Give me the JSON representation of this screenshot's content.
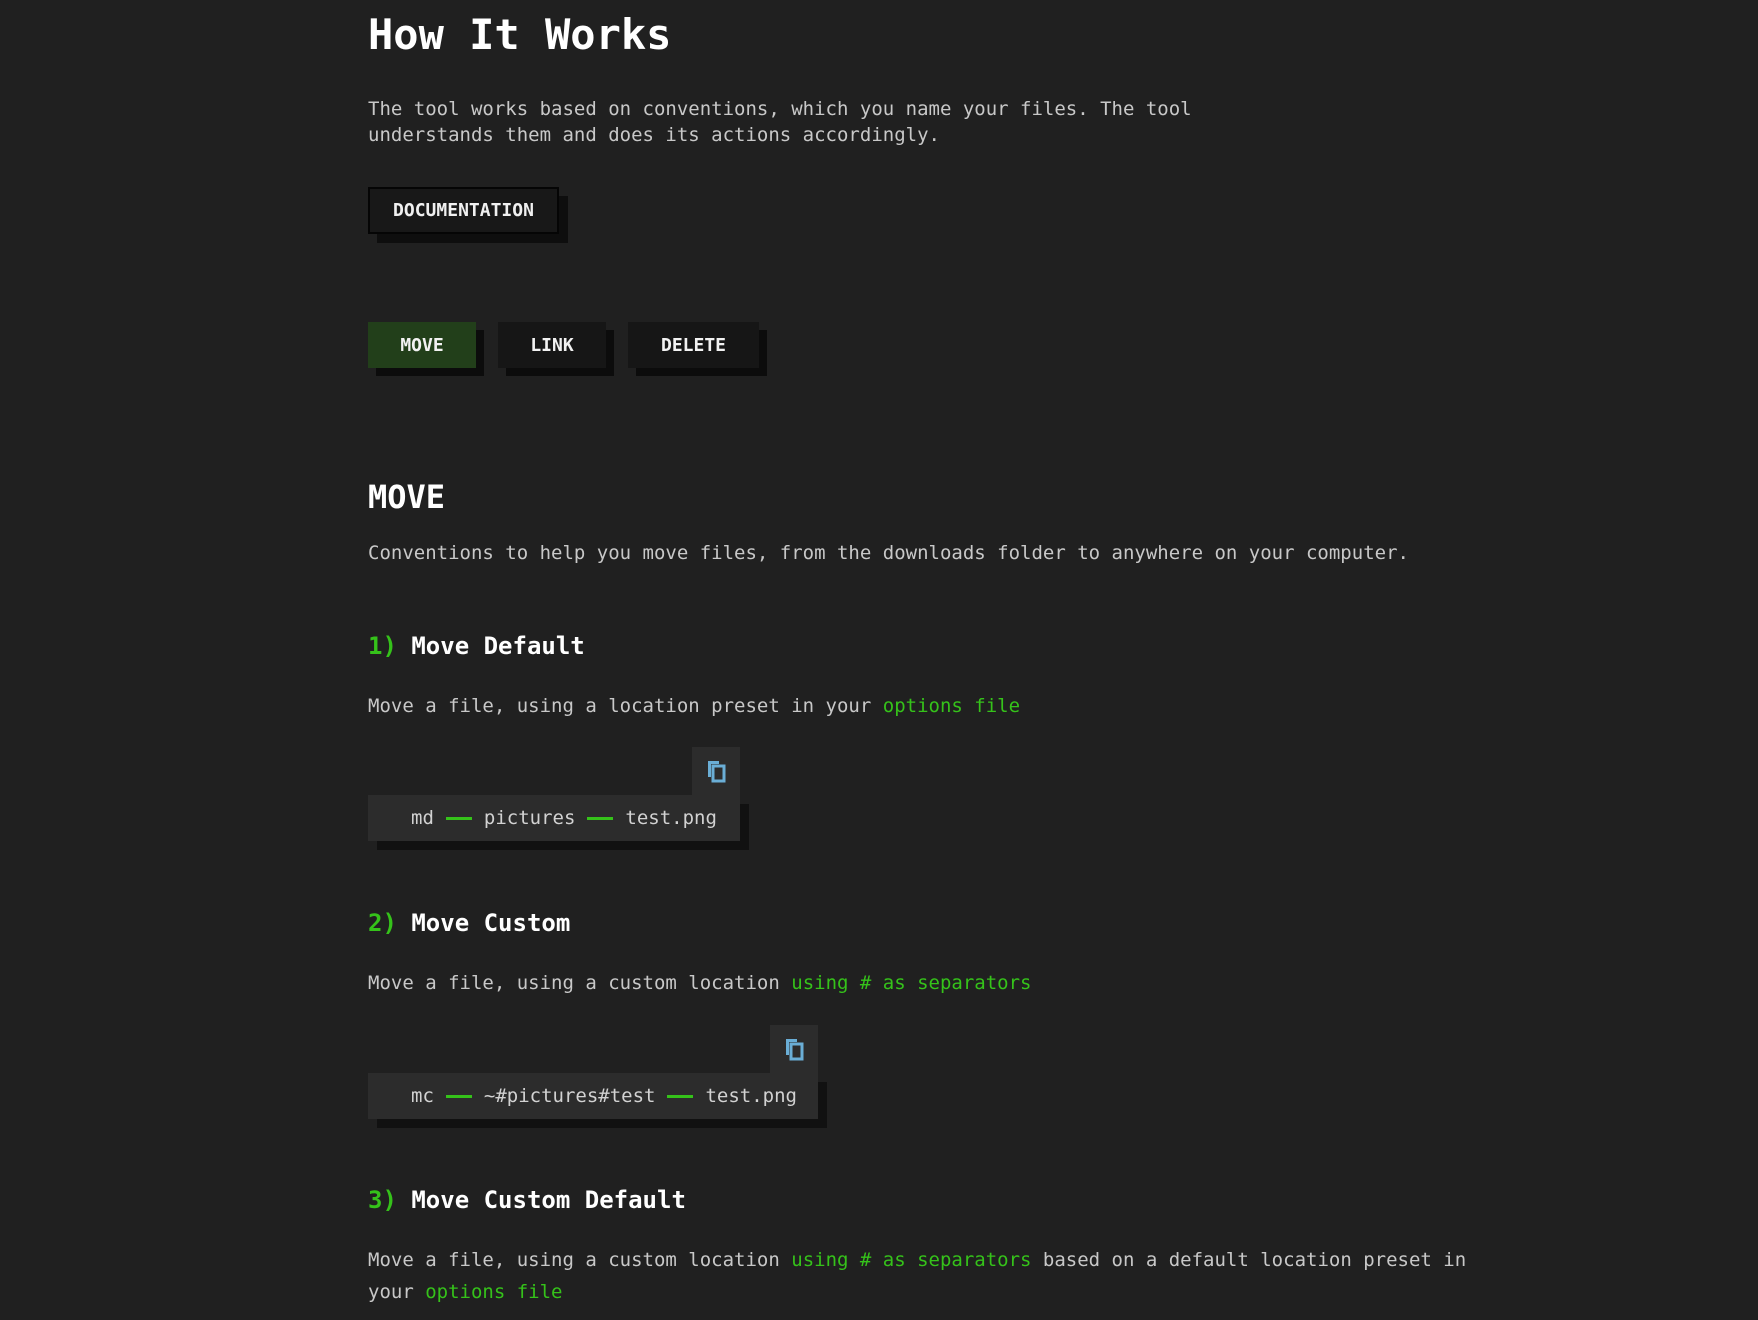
{
  "page": {
    "title": "How It Works",
    "intro_line1": "The tool works based on conventions, which you name your files. The tool",
    "intro_line2": "understands them and does its actions accordingly.",
    "doc_button": "DOCUMENTATION"
  },
  "tabs": [
    {
      "label": "MOVE",
      "active": true
    },
    {
      "label": "LINK",
      "active": false
    },
    {
      "label": "DELETE",
      "active": false
    }
  ],
  "section": {
    "title": "MOVE",
    "description": "Conventions to help you move files, from the downloads folder to anywhere on your computer."
  },
  "items": [
    {
      "number": "1)",
      "title": "Move Default",
      "desc_prefix": "Move a file, using a location preset in your ",
      "desc_link": "options file",
      "code": {
        "cmd": "md",
        "arg": "pictures",
        "file": "test.png"
      }
    },
    {
      "number": "2)",
      "title": "Move Custom",
      "desc_prefix": "Move a file, using a custom location ",
      "desc_link": "using # as separators",
      "code": {
        "cmd": "mc",
        "arg": "~#pictures#test",
        "file": "test.png"
      }
    },
    {
      "number": "3)",
      "title": "Move Custom Default",
      "desc_prefix": "Move a file, using a custom location ",
      "desc_link": "using # as separators",
      "desc_middle": " based on a default location preset in your ",
      "desc_link2": "options file"
    }
  ],
  "colors": {
    "background": "#202020",
    "accent_green": "#35c21a",
    "active_tab": "#223f1a",
    "copy_icon": "#6aaed6"
  },
  "icons": {
    "copy": "copy-icon"
  }
}
